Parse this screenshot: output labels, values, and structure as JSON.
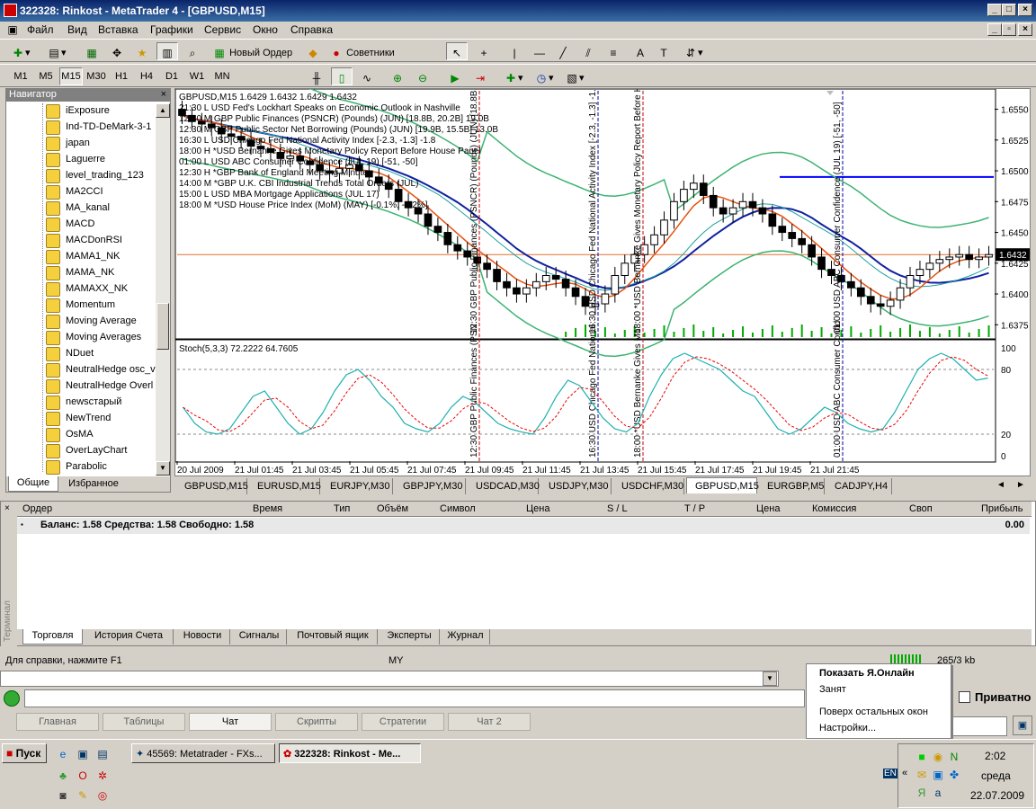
{
  "window": {
    "title": "322328: Rinkost - MetaTrader 4 - [GBPUSD,M15]"
  },
  "menu": [
    "Файл",
    "Вид",
    "Вставка",
    "Графики",
    "Сервис",
    "Окно",
    "Справка"
  ],
  "toolbar": {
    "new_order": "Новый Ордер",
    "experts": "Советники"
  },
  "timeframes": [
    "M1",
    "M5",
    "M15",
    "M30",
    "H1",
    "H4",
    "D1",
    "W1",
    "MN"
  ],
  "active_timeframe": "M15",
  "navigator": {
    "title": "Навигатор",
    "items": [
      "iExposure",
      "Ind-TD-DeMark-3-1",
      "japan",
      "Laguerre",
      "level_trading_123",
      "MA2CCI",
      "MA_kanal",
      "MACD",
      "MACDonRSI",
      "MAMA1_NK",
      "MAMA_NK",
      "MAMAXX_NK",
      "Momentum",
      "Moving Average",
      "Moving Averages",
      "NDuet",
      "NeutralHedge osc_v",
      "NeutralHedge Overl",
      "newsстарый",
      "NewTrend",
      "OsMA",
      "OverLayChart",
      "Parabolic"
    ],
    "tabs": [
      "Общие",
      "Избранное"
    ]
  },
  "chart": {
    "header": "GBPUSD,M15  1.6429 1.6432 1.6429 1.6432",
    "news": [
      "21:30 L USD Fed's Lockhart Speaks on Economic Outlook in Nashville",
      "12:30 M GBP Public Finances (PSNCR) (Pounds) (JUN) [18.8B, 20.2B] 19.0B",
      "12:30 M GBP Public Sector Net Borrowing (Pounds) (JUN) [19.9B, 15.5B] 13.0B",
      "16:30 L USD Chicago Fed National Activity Index [-2.3, -1.3] -1.8",
      "18:00 H *USD Bernanke Gives Monetary Policy Report Before House Panel",
      "01:00 L USD ABC Consumer Confidence (JUL 19) [-51, -50]",
      "12:30 H *GBP Bank of England Meeting Minutes",
      "14:00 M *GBP U.K. CBI Industrial Trends Total Orders (JUL)",
      "15:00 L USD MBA Mortgage Applications (JUL 17)",
      "18:00 M *USD House Price Index (MoM) (MAY) [-0.1%, -0.2%]"
    ],
    "vertical_labels": [
      "12:30 GBP Public Finances (PSNCR) (Pounds) (JUN) [18.8B, 20.2B]",
      "16:30 USD Chicago Fed National Activity Index [-2.3, -1.3] -1.8",
      "18:00 *USD Bernanke Gives Monetary Policy Report Before House",
      "01:00 USD ABC Consumer Confidence (JUL 19) [-51, -50]"
    ],
    "sub_vertical_labels": [
      "12:30 GBP Public Finances (PSN",
      "16:30 USD Chicago Fed National",
      "18:00 *USD Bernanke Gives Mo",
      "01:00 USD ABC Consumer Confid"
    ],
    "price_ticks": [
      "1.6550",
      "1.6525",
      "1.6500",
      "1.6475",
      "1.6450",
      "1.6425",
      "1.6400",
      "1.6375"
    ],
    "current_price": "1.6432",
    "stoch_label": "Stoch(5,3,3) 72.2222 64.7605",
    "stoch_ticks": [
      "100",
      "80",
      "20",
      "0"
    ],
    "time_ticks": [
      "20 Jul 2009",
      "21 Jul 01:45",
      "21 Jul 03:45",
      "21 Jul 05:45",
      "21 Jul 07:45",
      "21 Jul 09:45",
      "21 Jul 11:45",
      "21 Jul 13:45",
      "21 Jul 15:45",
      "21 Jul 17:45",
      "21 Jul 19:45",
      "21 Jul 21:45"
    ]
  },
  "chart_data": {
    "type": "candlestick",
    "symbol": "GBPUSD",
    "timeframe": "M15",
    "ylim": [
      1.6365,
      1.6565
    ],
    "close": [
      1.6545,
      1.654,
      1.6538,
      1.6535,
      1.653,
      1.6528,
      1.6525,
      1.652,
      1.6518,
      1.6515,
      1.651,
      1.6512,
      1.6508,
      1.6505,
      1.65,
      1.6498,
      1.6502,
      1.6505,
      1.65,
      1.6495,
      1.649,
      1.6485,
      1.6475,
      1.647,
      1.6465,
      1.6455,
      1.645,
      1.644,
      1.6435,
      1.643,
      1.6425,
      1.642,
      1.641,
      1.6405,
      1.64,
      1.6405,
      1.641,
      1.6415,
      1.6412,
      1.6405,
      1.6398,
      1.639,
      1.6392,
      1.64,
      1.6415,
      1.6425,
      1.6432,
      1.644,
      1.6448,
      1.646,
      1.6475,
      1.6485,
      1.649,
      1.648,
      1.647,
      1.6465,
      1.647,
      1.6475,
      1.647,
      1.6465,
      1.6455,
      1.645,
      1.6445,
      1.644,
      1.643,
      1.642,
      1.6415,
      1.641,
      1.6405,
      1.6398,
      1.6392,
      1.639,
      1.6395,
      1.6405,
      1.6415,
      1.642,
      1.6425,
      1.6428,
      1.643,
      1.6432,
      1.6428,
      1.643,
      1.6432
    ],
    "stoch_k": [
      45,
      30,
      22,
      20,
      25,
      40,
      55,
      60,
      45,
      30,
      20,
      25,
      40,
      60,
      75,
      80,
      70,
      55,
      45,
      30,
      25,
      22,
      30,
      45,
      55,
      50,
      40,
      30,
      25,
      22,
      20,
      35,
      55,
      70,
      65,
      50,
      35,
      25,
      22,
      30,
      55,
      75,
      90,
      95,
      90,
      85,
      80,
      70,
      60,
      55,
      40,
      25,
      20,
      25,
      35,
      45,
      40,
      30,
      25,
      22,
      25,
      40,
      60,
      80,
      90,
      95,
      90,
      80,
      70,
      72
    ]
  },
  "symbol_tabs": [
    "GBPUSD,M15",
    "EURUSD,M15",
    "EURJPY,M30",
    "GBPJPY,M30",
    "USDCAD,M30",
    "USDJPY,M30",
    "USDCHF,M30",
    "GBPUSD,M15",
    "EURGBP,M5",
    "CADJPY,H4"
  ],
  "active_symbol_tab": 7,
  "terminal": {
    "side_label": "Терминал",
    "columns": [
      "Ордер",
      "Время",
      "Тип",
      "Объём",
      "Символ",
      "Цена",
      "S / L",
      "T / P",
      "Цена",
      "Комиссия",
      "Своп",
      "Прибыль"
    ],
    "balance_line": "Баланс: 1.58  Средства: 1.58  Свободно: 1.58",
    "profit": "0.00",
    "tabs": [
      "Торговля",
      "История Счета",
      "Новости",
      "Сигналы",
      "Почтовый ящик",
      "Эксперты",
      "Журнал"
    ]
  },
  "status": {
    "help": "Для справки, нажмите F1",
    "profile": "MY",
    "traffic": "265/3 kb"
  },
  "popup": {
    "items": [
      "Показать Я.Онлайн",
      "Занят",
      "Поверх остальных окон",
      "Настройки..."
    ]
  },
  "private_label": "Приватно",
  "bottom_tabs": [
    "Главная",
    "Таблицы",
    "Чат",
    "Скрипты",
    "Стратегии",
    "Чат 2"
  ],
  "taskbar": {
    "start": "Пуск",
    "task1": "45569: Metatrader - FXs...",
    "task2": "322328: Rinkost - Me...",
    "lang": "EN",
    "time": "2:02",
    "day": "среда",
    "date": "22.07.2009"
  }
}
